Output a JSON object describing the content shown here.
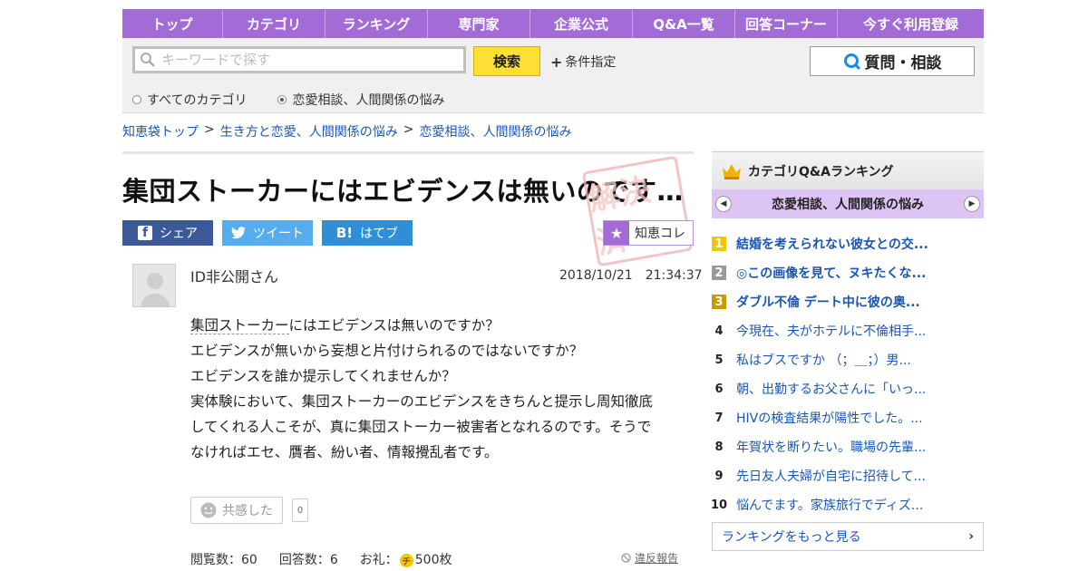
{
  "nav": [
    "トップ",
    "カテゴリ",
    "ランキング",
    "専門家",
    "企業公式",
    "Q&A一覧",
    "回答コーナー",
    "今すぐ利用登録"
  ],
  "search": {
    "placeholder": "キーワードで探す",
    "button": "検索",
    "condition": "条件指定",
    "ask_button": "質問・相談"
  },
  "scope": {
    "all": "すべてのカテゴリ",
    "current": "恋愛相談、人間関係の悩み"
  },
  "breadcrumb": [
    "知恵袋トップ",
    "生き方と恋愛、人間関係の悩み",
    "恋愛相談、人間関係の悩み"
  ],
  "question": {
    "title": "集団ストーカーにはエビデンスは無いのです…",
    "stamp": "解決済",
    "share": {
      "facebook": "シェア",
      "twitter": "ツイート",
      "hatena": "はてブ",
      "hatena_logo": "B!"
    },
    "chie_coll": "知恵コレ",
    "user": "ID非公開さん",
    "date": "2018/10/21　21:34:37",
    "body_first_kw": "集団ストーカー",
    "body_first_rest": "にはエビデンスは無いのですか？",
    "body_lines": [
      "エビデンスが無いから妄想と片付けられるのではないですか？",
      "エビデンスを誰か提示してくれませんか？",
      "実体験において、集団ストーカーのエビデンスをきちんと提示し周知徹底",
      "してくれる人こそが、真に集団ストーカー被害者となれるのです。そうで",
      "なければエセ、贋者、紛い者、情報攪乱者です。"
    ],
    "empathy_label": "共感した",
    "empathy_count": "0",
    "views": "閲覧数：60",
    "answers": "回答数：6",
    "reward_label": "お礼：",
    "reward_value": "500枚",
    "coin": "チ",
    "report": "違反報告"
  },
  "sidebar": {
    "heading": "カテゴリQ&Aランキング",
    "category": "恋愛相談、人間関係の悩み",
    "ranking": [
      {
        "n": "1",
        "t": "結婚を考えられない彼女との交..."
      },
      {
        "n": "2",
        "t": "◎この画像を見て、ヌキたくな..."
      },
      {
        "n": "3",
        "t": "ダブル不倫 デート中に彼の奥..."
      },
      {
        "n": "4",
        "t": "今現在、夫がホテルに不倫相手..."
      },
      {
        "n": "5",
        "t": "私はブスですか （；＿；）男..."
      },
      {
        "n": "6",
        "t": "朝、出勤するお父さんに「いっ..."
      },
      {
        "n": "7",
        "t": "HIVの検査結果が陽性でした。..."
      },
      {
        "n": "8",
        "t": "年賀状を断りたい。職場の先輩..."
      },
      {
        "n": "9",
        "t": "先日友人夫婦が自宅に招待して..."
      },
      {
        "n": "10",
        "t": "悩んでます。家族旅行でディズ..."
      }
    ],
    "more": "ランキングをもっと見る"
  },
  "colors": {
    "nav": "#a36bd6",
    "link": "#1a56b4",
    "search_button": "#ffdf33"
  }
}
